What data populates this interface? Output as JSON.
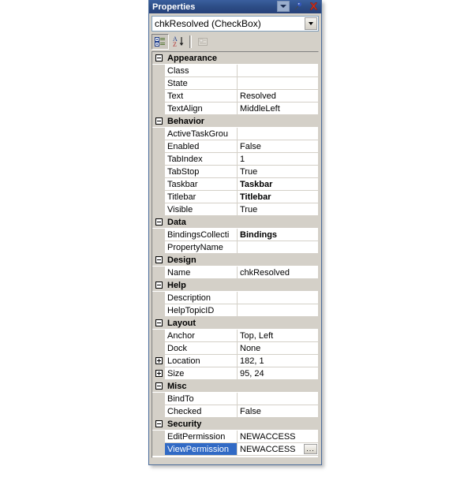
{
  "window": {
    "title": "Properties",
    "icons": {
      "dropdown": "chevron-down-icon",
      "pin": "pushpin-icon",
      "close": "close-x-icon"
    }
  },
  "object_selector": {
    "value": "chkResolved (CheckBox)",
    "dropdown_icon": "chevron-down-icon"
  },
  "toolbar": {
    "buttons": [
      {
        "name": "categorized-view-button",
        "icon": "categorized-icon",
        "pressed": true,
        "enabled": true
      },
      {
        "name": "alphabetical-view-button",
        "icon": "sort-az-icon",
        "pressed": false,
        "enabled": true
      },
      {
        "name": "property-pages-button",
        "icon": "property-pages-icon",
        "pressed": false,
        "enabled": false
      }
    ]
  },
  "colors": {
    "titlebar": "#2d4d86",
    "panel_face": "#d4d0c8",
    "selection": "#316ac5",
    "grid_line": "#d4d0c8",
    "close_icon": "#cc3322",
    "pin_icon": "#3355bb"
  },
  "grid": {
    "rows": [
      {
        "kind": "category",
        "expander": "minus",
        "label": "Appearance"
      },
      {
        "kind": "property",
        "name": "Class",
        "value": ""
      },
      {
        "kind": "property",
        "name": "State",
        "value": ""
      },
      {
        "kind": "property",
        "name": "Text",
        "value": "Resolved"
      },
      {
        "kind": "property",
        "name": "TextAlign",
        "value": "MiddleLeft"
      },
      {
        "kind": "category",
        "expander": "minus",
        "label": "Behavior"
      },
      {
        "kind": "property",
        "name": "ActiveTaskGrou",
        "value": ""
      },
      {
        "kind": "property",
        "name": "Enabled",
        "value": "False"
      },
      {
        "kind": "property",
        "name": "TabIndex",
        "value": "1"
      },
      {
        "kind": "property",
        "name": "TabStop",
        "value": "True"
      },
      {
        "kind": "property",
        "name": "Taskbar",
        "value": "Taskbar",
        "bold": true
      },
      {
        "kind": "property",
        "name": "Titlebar",
        "value": "Titlebar",
        "bold": true
      },
      {
        "kind": "property",
        "name": "Visible",
        "value": "True"
      },
      {
        "kind": "category",
        "expander": "minus",
        "label": "Data"
      },
      {
        "kind": "property",
        "name": "BindingsCollecti",
        "value": "Bindings",
        "bold": true
      },
      {
        "kind": "property",
        "name": "PropertyName",
        "value": ""
      },
      {
        "kind": "category",
        "expander": "minus",
        "label": "Design"
      },
      {
        "kind": "property",
        "name": "Name",
        "value": "chkResolved"
      },
      {
        "kind": "category",
        "expander": "minus",
        "label": "Help"
      },
      {
        "kind": "property",
        "name": "Description",
        "value": ""
      },
      {
        "kind": "property",
        "name": "HelpTopicID",
        "value": ""
      },
      {
        "kind": "category",
        "expander": "minus",
        "label": "Layout"
      },
      {
        "kind": "property",
        "name": "Anchor",
        "value": "Top, Left"
      },
      {
        "kind": "property",
        "name": "Dock",
        "value": "None"
      },
      {
        "kind": "property",
        "expander": "plus",
        "name": "Location",
        "value": "182, 1"
      },
      {
        "kind": "property",
        "expander": "plus",
        "name": "Size",
        "value": "95, 24"
      },
      {
        "kind": "category",
        "expander": "minus",
        "label": "Misc"
      },
      {
        "kind": "property",
        "name": "BindTo",
        "value": ""
      },
      {
        "kind": "property",
        "name": "Checked",
        "value": "False"
      },
      {
        "kind": "category",
        "expander": "minus",
        "label": "Security"
      },
      {
        "kind": "property",
        "name": "EditPermission",
        "value": "NEWACCESS"
      },
      {
        "kind": "property",
        "name": "ViewPermission",
        "value": "NEWACCESS",
        "selected": true,
        "ellipsis": "..."
      }
    ]
  }
}
